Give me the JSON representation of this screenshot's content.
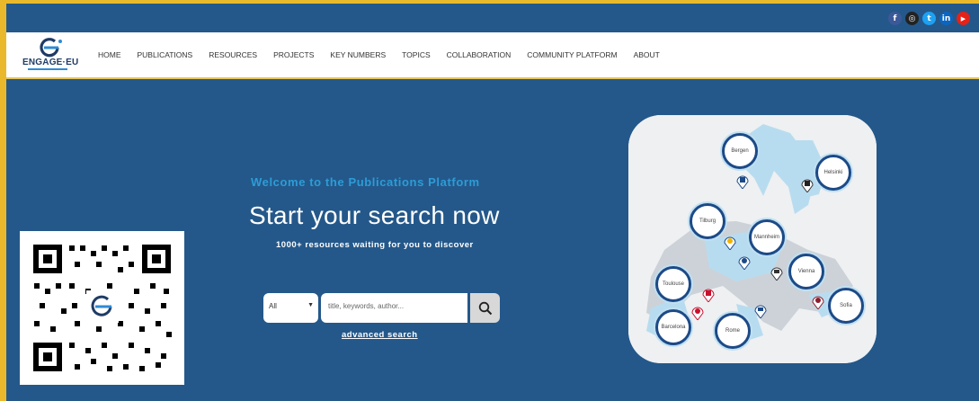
{
  "social": {
    "items": [
      {
        "name": "facebook-icon",
        "glyph": "f",
        "color": "#3b5998"
      },
      {
        "name": "instagram-icon",
        "glyph": "◎",
        "color": "#222222"
      },
      {
        "name": "twitter-icon",
        "glyph": "t",
        "color": "#1da1f2"
      },
      {
        "name": "linkedin-icon",
        "glyph": "in",
        "color": "#0a66c2"
      },
      {
        "name": "youtube-icon",
        "glyph": "▶",
        "color": "#e62117"
      }
    ]
  },
  "brand": {
    "logo_text": "ENGAGE·EU"
  },
  "nav": {
    "items": [
      "HOME",
      "PUBLICATIONS",
      "RESOURCES",
      "PROJECTS",
      "KEY NUMBERS",
      "TOPICS",
      "COLLABORATION",
      "COMMUNITY PLATFORM",
      "ABOUT"
    ]
  },
  "hero": {
    "welcome": "Welcome to the Publications Platform",
    "title": "Start your search now",
    "subtitle": "1000+ resources waiting for you to discover",
    "advanced_search": "advanced search"
  },
  "search": {
    "filter_value": "All",
    "placeholder": "title, keywords, author..."
  },
  "map": {
    "cities": [
      "Bergen",
      "Helsinki",
      "Tilburg",
      "Mannheim",
      "Vienna",
      "Toulouse",
      "Sofia",
      "Barcelona",
      "Rome"
    ]
  },
  "colors": {
    "background": "#24588a",
    "accent": "#2d9cd6",
    "border": "#e9b92b"
  }
}
